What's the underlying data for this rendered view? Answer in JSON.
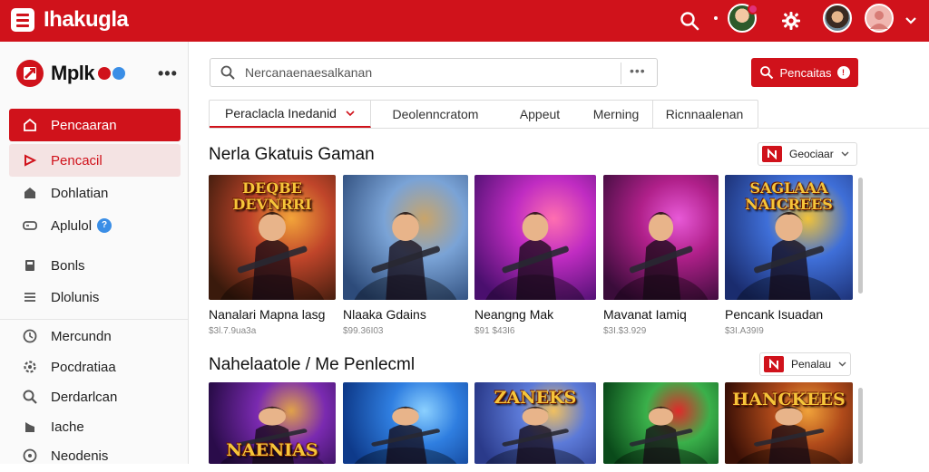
{
  "topbar": {
    "title": "Ihakugla",
    "icons": [
      "menu-icon",
      "search-icon",
      "notification-avatar",
      "gear-icon",
      "user-avatar",
      "profile-avatar",
      "chevron-down-icon"
    ],
    "accent": "#d0121b"
  },
  "sidebar": {
    "brand": "Mplk",
    "more": "•••",
    "items": [
      {
        "label": "Pencaaran",
        "icon": "home-icon",
        "state": "active"
      },
      {
        "label": "Pencacil",
        "icon": "game-icon",
        "state": "hover"
      },
      {
        "label": "Dohlatian",
        "icon": "store-icon"
      },
      {
        "label": "Aplulol",
        "icon": "gamepad-icon",
        "badge": "?"
      },
      {
        "label": "Bonls",
        "icon": "bookmark-icon"
      },
      {
        "label": "Dlolunis",
        "icon": "list-icon"
      },
      {
        "label": "Mercundn",
        "icon": "clock-icon"
      },
      {
        "label": "Pocdratiaa",
        "icon": "settings-icon"
      },
      {
        "label": "Derdarlcan",
        "icon": "search-icon"
      },
      {
        "label": "Iache",
        "icon": "flag-icon"
      },
      {
        "label": "Neodenis",
        "icon": "info-icon"
      }
    ]
  },
  "search": {
    "placeholder": "Nercanaenaesalkanan",
    "more": "•••",
    "button_label": "Pencaitas",
    "button_badge": "!"
  },
  "tabs": [
    {
      "label": "Peraclacla Inedanid",
      "active": true
    },
    {
      "label": "Deolenncratom"
    },
    {
      "label": "Appeut"
    },
    {
      "label": "Merning"
    },
    {
      "label": "Ricnnaalenan"
    }
  ],
  "sections": [
    {
      "title": "Nerla Gkatuis Gaman",
      "sort_label": "Geociaar",
      "cards": [
        {
          "title": "Nanalari Mapna lasg",
          "meta": "$3l.7.9ua3a",
          "art_text": "DEQBE DEVNRRI",
          "palette": [
            "#3a1a0c",
            "#c0452a",
            "#f2a43a"
          ]
        },
        {
          "title": "Nlaaka Gdains",
          "meta": "$99.36I03",
          "art_text": "",
          "palette": [
            "#2d4b7a",
            "#7aa3d6",
            "#c9a46a"
          ]
        },
        {
          "title": "Neangng Mak",
          "meta": "$91 $43I6",
          "art_text": "",
          "palette": [
            "#4a0f6e",
            "#c02cc2",
            "#ff6fb0"
          ]
        },
        {
          "title": "Mavanat Iamiq",
          "meta": "$3I.$3.929",
          "art_text": "",
          "palette": [
            "#3a0c3a",
            "#b0208a",
            "#e85ad8"
          ]
        },
        {
          "title": "Pencank Isuadan",
          "meta": "$3I.A39I9",
          "art_text": "SAGLAAA NAICREES",
          "palette": [
            "#1a2c6e",
            "#3f6fd8",
            "#f0c23a"
          ]
        }
      ]
    },
    {
      "title": "Nahelaatole / Me Penlecml",
      "sort_label": "Penalau",
      "cards": [
        {
          "title": "",
          "meta": "",
          "art_text": "NAENIAS",
          "palette": [
            "#2a0c4a",
            "#7a2ab0",
            "#e0a24a"
          ]
        },
        {
          "title": "",
          "meta": "",
          "art_text": "",
          "palette": [
            "#0e3a8a",
            "#2f7ee0",
            "#8bd0ff"
          ]
        },
        {
          "title": "",
          "meta": "",
          "art_text": "ZANEKS",
          "palette": [
            "#2a3a8a",
            "#5c7ad8",
            "#f0c060"
          ]
        },
        {
          "title": "",
          "meta": "",
          "art_text": "",
          "palette": [
            "#0a4a1a",
            "#3ab04a",
            "#e02a2a"
          ]
        },
        {
          "title": "",
          "meta": "",
          "art_text": "HANCKEES",
          "palette": [
            "#3a1006",
            "#b04a1a",
            "#f0a23a"
          ]
        }
      ]
    }
  ]
}
